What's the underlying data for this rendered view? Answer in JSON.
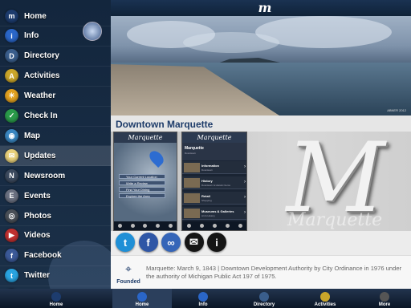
{
  "sidebar": {
    "items": [
      {
        "label": "Home",
        "icon": "home-icon",
        "color": "#1d3c6e",
        "glyph": "m"
      },
      {
        "label": "Info",
        "icon": "info-icon",
        "color": "#2a66c8",
        "glyph": "i"
      },
      {
        "label": "Directory",
        "icon": "directory-icon",
        "color": "#3a5e8c",
        "glyph": "D"
      },
      {
        "label": "Activities",
        "icon": "activities-icon",
        "color": "#c9a52a",
        "glyph": "A"
      },
      {
        "label": "Weather",
        "icon": "weather-icon",
        "color": "#e0a020",
        "glyph": "☀"
      },
      {
        "label": "Check In",
        "icon": "check-in-icon",
        "color": "#2a9a4a",
        "glyph": "✓"
      },
      {
        "label": "Map",
        "icon": "map-icon",
        "color": "#3a86c0",
        "glyph": "◉"
      },
      {
        "label": "Updates",
        "icon": "updates-icon",
        "color": "#e8d07a",
        "glyph": "✉"
      },
      {
        "label": "Newsroom",
        "icon": "newsroom-icon",
        "color": "#3c4a5e",
        "glyph": "N"
      },
      {
        "label": "Events",
        "icon": "events-icon",
        "color": "#6a7080",
        "glyph": "E"
      },
      {
        "label": "Photos",
        "icon": "photos-icon",
        "color": "#4a5058",
        "glyph": "◎"
      },
      {
        "label": "Videos",
        "icon": "videos-icon",
        "color": "#c03030",
        "glyph": "▶"
      },
      {
        "label": "Facebook",
        "icon": "facebook-icon",
        "color": "#3b5998",
        "glyph": "f"
      },
      {
        "label": "Twitter",
        "icon": "twitter-icon",
        "color": "#29a3e0",
        "glyph": "t"
      },
      {
        "label": "",
        "icon": "more-icon",
        "color": "#6a8ab0",
        "glyph": ""
      }
    ],
    "active_index": 7
  },
  "header": {
    "logo": "m"
  },
  "photo": {
    "credit": "ABNER 2012"
  },
  "main": {
    "title": "Downtown Marquette"
  },
  "showcase": {
    "big_letter": "M",
    "watermark": "Marquette",
    "phone1": {
      "header": "Marquette",
      "buttons": [
        "Your Current Location",
        "Write a Review",
        "Find Your Dining",
        "Explore the Area"
      ]
    },
    "phone2": {
      "header": "Marquette",
      "sub_title": "Marquette",
      "sub_text": "Downtown",
      "rows": [
        {
          "title": "Information",
          "sub": "Downtown"
        },
        {
          "title": "History",
          "sub": "Downtown & Historic Items"
        },
        {
          "title": "Retail",
          "sub": "Shopping"
        },
        {
          "title": "Museums & Galleries",
          "sub": "Art & History"
        }
      ]
    }
  },
  "social": [
    {
      "icon": "twitter-icon",
      "glyph": "t",
      "color": "#1f8fd6"
    },
    {
      "icon": "facebook-icon",
      "glyph": "f",
      "color": "#2f56a6"
    },
    {
      "icon": "link-icon",
      "glyph": "∞",
      "color": "#3565b8"
    },
    {
      "icon": "email-icon",
      "glyph": "✉",
      "color": "#151515"
    },
    {
      "icon": "info-icon",
      "glyph": "i",
      "color": "#151515"
    }
  ],
  "founded": {
    "label": "Founded",
    "text": "Marquette: March 9, 1843 | Downtown Development Authority by City Ordinance in 1976 under the authority of Michigan Public Act 197 of 1975."
  },
  "tabbar": {
    "tabs": [
      {
        "label": "Home",
        "icon": "home-icon"
      },
      {
        "label": "Home",
        "icon": "home-icon"
      },
      {
        "label": "Info",
        "icon": "info-icon"
      },
      {
        "label": "Directory",
        "icon": "directory-icon"
      },
      {
        "label": "Activities",
        "icon": "activities-icon"
      },
      {
        "label": "More",
        "icon": "more-icon"
      }
    ],
    "active_index": 1
  }
}
